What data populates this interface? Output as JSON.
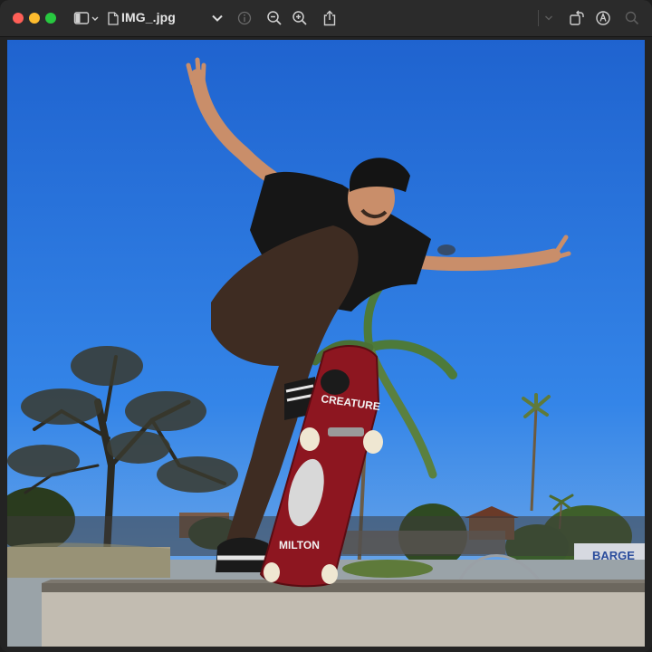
{
  "window": {
    "title": "IMG_.jpg",
    "traffic_lights": {
      "close": "#ff5f57",
      "minimize": "#febc2e",
      "maximize": "#28c840"
    }
  },
  "toolbar": {
    "left_icons": [
      "sidebar-toggle-icon",
      "document-icon",
      "title-menu-chevron-icon"
    ],
    "center_icons": [
      "info-icon",
      "zoom-out-icon",
      "zoom-in-icon",
      "share-icon"
    ],
    "right_icons": [
      "markup-dropdown-chevron-icon",
      "rotate-icon",
      "markup-pen-icon",
      "search-icon"
    ]
  },
  "photo": {
    "description_icon": "skateboarder-photo",
    "board_text_top": "CREATURE",
    "board_text_bottom": "MILTON",
    "graffiti_text": "BARGE",
    "sky_color": "#2d77e0"
  }
}
